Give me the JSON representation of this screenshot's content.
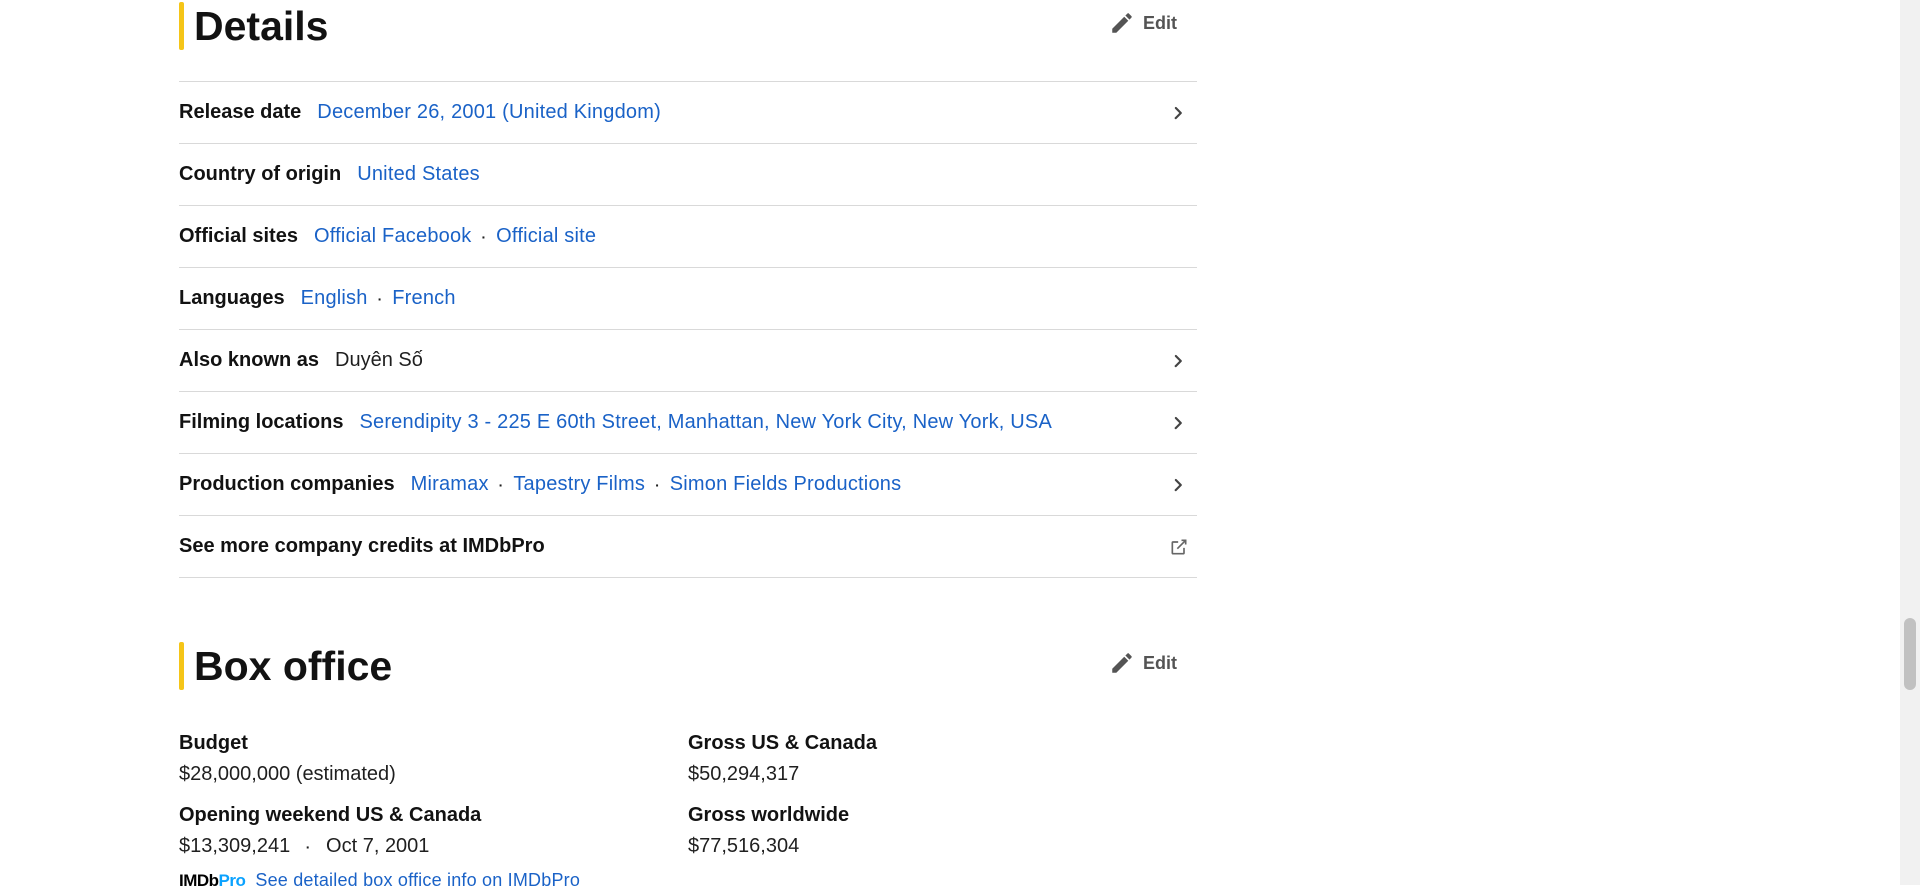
{
  "details": {
    "title": "Details",
    "edit_label": "Edit",
    "rows": {
      "release": {
        "label": "Release date",
        "value": "December 26, 2001 (United Kingdom)"
      },
      "country": {
        "label": "Country of origin",
        "value": "United States"
      },
      "sites": {
        "label": "Official sites",
        "values": [
          "Official Facebook",
          "Official site"
        ]
      },
      "languages": {
        "label": "Languages",
        "values": [
          "English",
          "French"
        ]
      },
      "aka": {
        "label": "Also known as",
        "value": "Duyên Số"
      },
      "filming": {
        "label": "Filming locations",
        "value": "Serendipity 3 - 225 E 60th Street, Manhattan, New York City, New York, USA"
      },
      "production": {
        "label": "Production companies",
        "values": [
          "Miramax",
          "Tapestry Films",
          "Simon Fields Productions"
        ]
      },
      "more_credits": {
        "label": "See more company credits at IMDbPro"
      }
    }
  },
  "box_office": {
    "title": "Box office",
    "edit_label": "Edit",
    "budget": {
      "label": "Budget",
      "value": "$28,000,000 (estimated)"
    },
    "gross_us": {
      "label": "Gross US & Canada",
      "value": "$50,294,317"
    },
    "opening": {
      "label": "Opening weekend US & Canada",
      "amount": "$13,309,241",
      "date": "Oct 7, 2001"
    },
    "gross_world": {
      "label": "Gross worldwide",
      "value": "$77,516,304"
    },
    "pro_logo_imdb": "IMDb",
    "pro_logo_pro": "Pro",
    "pro_link": "See detailed box office info on IMDbPro"
  },
  "colors": {
    "accent": "#f5c518",
    "link": "#1a62c7",
    "divider": "#d9d9d9"
  },
  "icons": {
    "edit": "pencil-icon",
    "row_arrow": "chevron-right-icon",
    "external": "external-link-icon"
  }
}
